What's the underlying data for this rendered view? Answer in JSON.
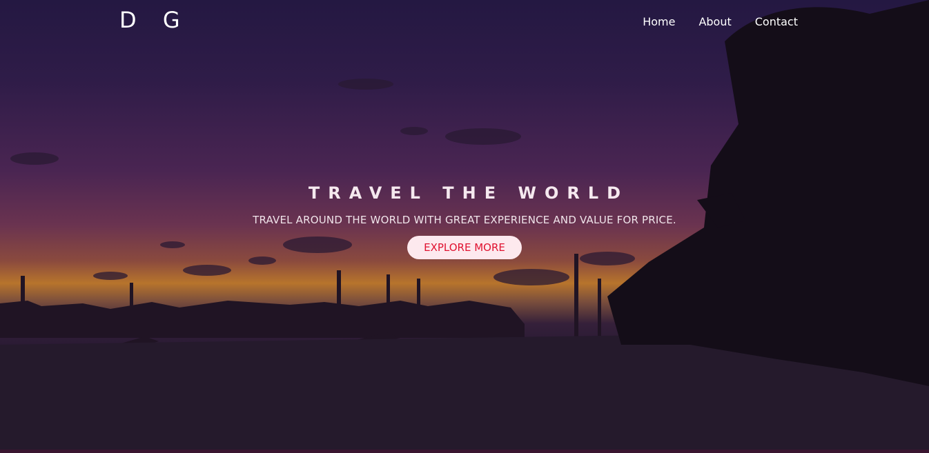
{
  "brand": {
    "logo_text": "D G"
  },
  "nav": {
    "items": [
      {
        "label": "Home"
      },
      {
        "label": "About"
      },
      {
        "label": "Contact"
      }
    ]
  },
  "hero": {
    "title": "TRAVEL THE WORLD",
    "subtitle": "TRAVEL AROUND THE WORLD WITH GREAT EXPERIENCE AND VALUE FOR PRICE.",
    "cta_label": "EXPLORE MORE"
  },
  "colors": {
    "accent": "#e0112f",
    "button_bg": "#fde9ee",
    "text": "#ffffff"
  }
}
